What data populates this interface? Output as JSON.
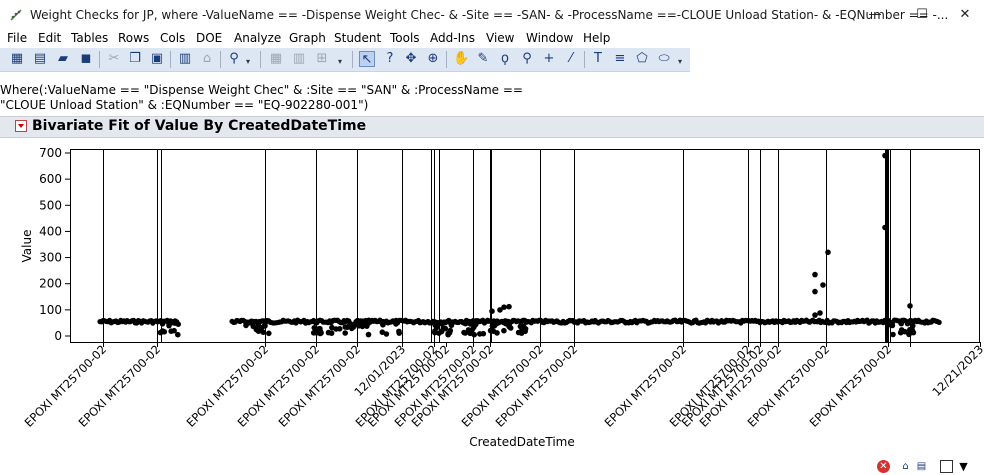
{
  "window": {
    "title": "Weight Checks for JP, where -ValueName == -Dispense Weight Chec- & -Site == -SAN- & -ProcessName ==-CLOUE Unload Station- & -EQNumber == -...",
    "minimize": "—",
    "maximize": "☐",
    "close": "✕"
  },
  "menu": [
    "File",
    "Edit",
    "Tables",
    "Rows",
    "Cols",
    "DOE",
    "Analyze",
    "Graph",
    "Student",
    "Tools",
    "Add-Ins",
    "View",
    "Window",
    "Help"
  ],
  "where": {
    "line1": "Where(:ValueName == \"Dispense Weight Chec\" & :Site == \"SAN\" & :ProcessName ==",
    "line2": "\"CLOUE Unload Station\" & :EQNumber == \"EQ-902280-001\")"
  },
  "report": {
    "title": "Bivariate Fit of Value By CreatedDateTime"
  },
  "colors": {
    "accent": "#c00000",
    "toolbar_bg": "#dde6f3",
    "points": "#000000"
  },
  "chart_data": {
    "type": "scatter",
    "xlabel": "CreatedDateTime",
    "ylabel": "Value",
    "ylim": [
      0,
      720
    ],
    "yticks": [
      0,
      100,
      200,
      300,
      400,
      500,
      600,
      700
    ],
    "x_axis_labels": [
      {
        "label": "EPOXI  MT25700-02"
      },
      {
        "label": "EPOXI  MT25700-02"
      },
      {
        "label": "EPOXI  MT25700-02"
      },
      {
        "label": "EPOXI  MT25700-02"
      },
      {
        "label": "EPOXI  MT25700-02"
      },
      {
        "label": "12/01/2023"
      },
      {
        "label": "EPOXI  MT25700-02"
      },
      {
        "label": "EPOXI  MT25700-02"
      },
      {
        "label": "EPOXI  MT25700-02"
      },
      {
        "label": "EPOXI  MT25700-02"
      },
      {
        "label": "EPOXI  MT25700-02"
      },
      {
        "label": "EPOXI  MT25700-02"
      },
      {
        "label": "EPOXI  MT25700-02"
      },
      {
        "label": "EPOXI  MT25700-02"
      },
      {
        "label": "EPOXI  MT25700-02"
      },
      {
        "label": "EPOXI  MT25700-02"
      },
      {
        "label": "EPOXI  MT25700-02"
      },
      {
        "label": "EPOXI  MT25700-02"
      },
      {
        "label": "12/21/2023"
      }
    ],
    "baseline_value": 55,
    "outliers": [
      {
        "y": 690
      },
      {
        "y": 415
      },
      {
        "y": 320
      },
      {
        "y": 235
      },
      {
        "y": 195
      },
      {
        "y": 170
      },
      {
        "y": 115
      },
      {
        "y": 112
      },
      {
        "y": 110
      },
      {
        "y": 100
      },
      {
        "y": 95
      },
      {
        "y": 88
      },
      {
        "y": 80
      }
    ]
  }
}
